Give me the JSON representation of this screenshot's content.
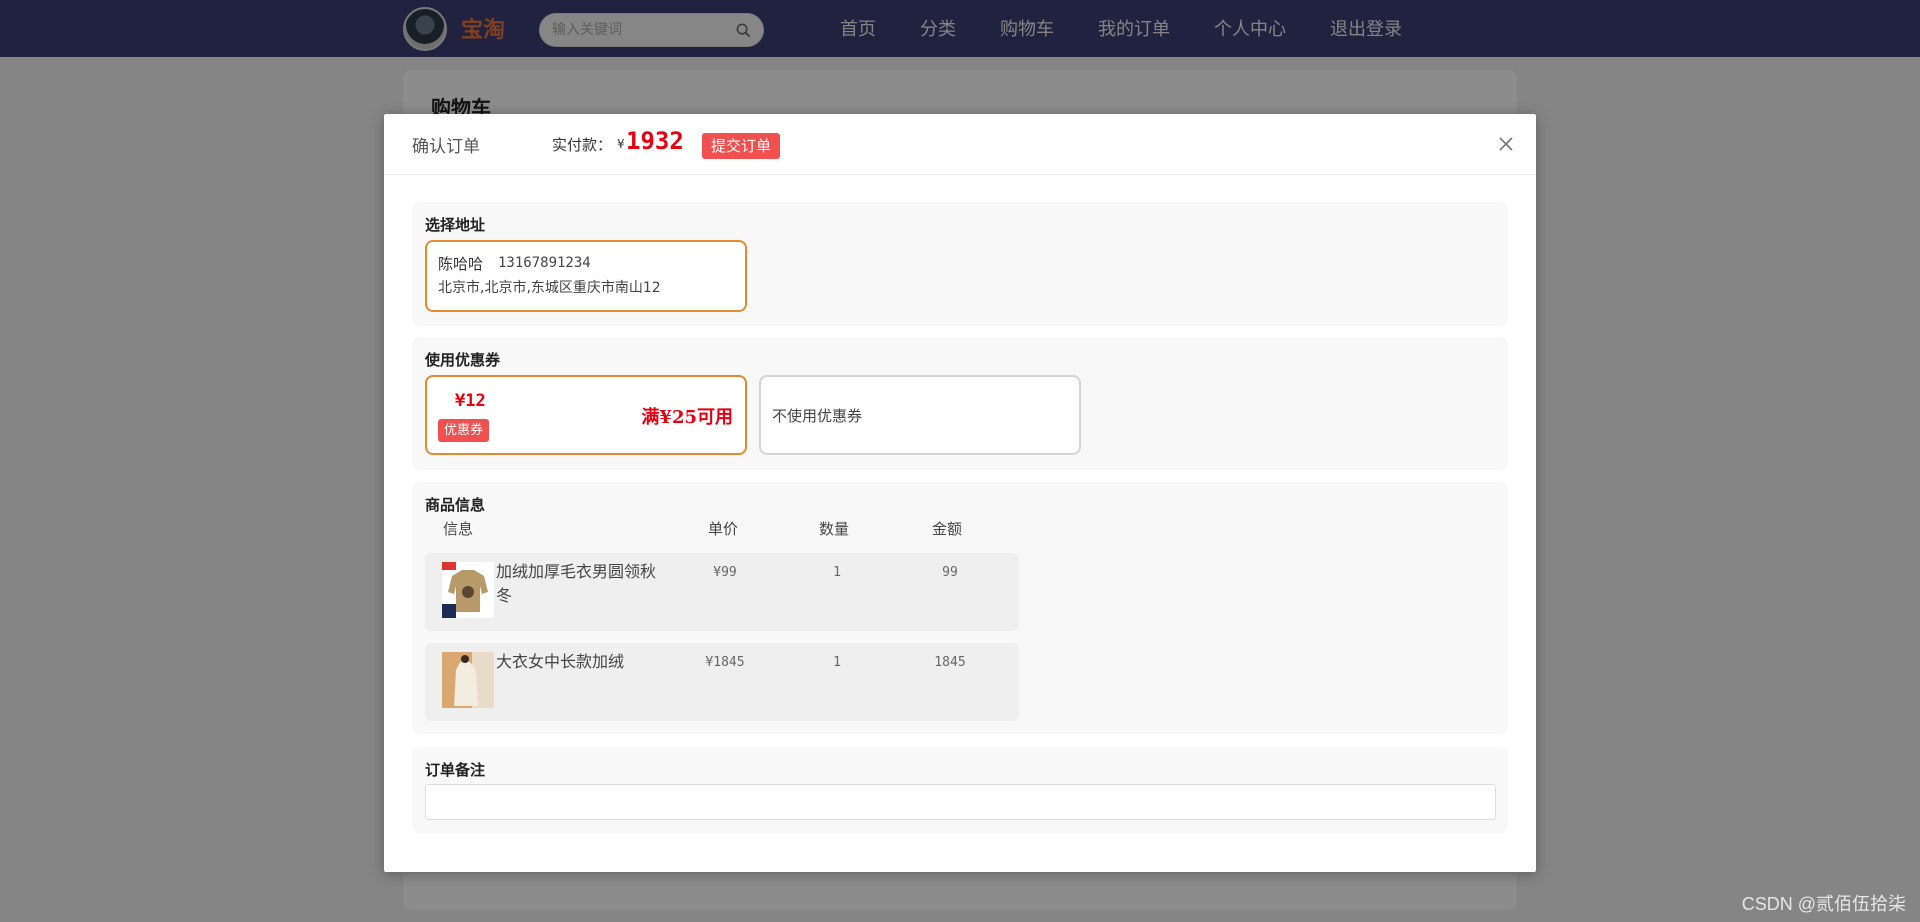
{
  "nav": {
    "logo_text": "宝淘",
    "search_placeholder": "输入关键词",
    "links": [
      "首页",
      "分类",
      "购物车",
      "我的订单",
      "个人中心",
      "退出登录"
    ]
  },
  "page": {
    "title": "购物车"
  },
  "dialog": {
    "title": "确认订单",
    "pay_label": "实付款：",
    "currency": "¥",
    "pay_amount": "1932",
    "submit_label": "提交订单"
  },
  "address": {
    "title": "选择地址",
    "name": "陈哈哈",
    "phone": "13167891234",
    "detail": "北京市,北京市,东城区重庆市南山12"
  },
  "coupon": {
    "title": "使用优惠券",
    "value": "¥12",
    "badge": "优惠券",
    "condition": "满¥25可用",
    "none_label": "不使用优惠券"
  },
  "goods": {
    "title": "商品信息",
    "columns": [
      "信息",
      "单价",
      "数量",
      "金额"
    ],
    "rows": [
      {
        "name": "加绒加厚毛衣男圆领秋冬",
        "price": "¥99",
        "qty": "1",
        "amount": "99"
      },
      {
        "name": "大衣女中长款加绒",
        "price": "¥1845",
        "qty": "1",
        "amount": "1845"
      }
    ]
  },
  "note": {
    "title": "订单备注",
    "value": ""
  },
  "watermark": "CSDN @贰佰伍拾柒",
  "colors": {
    "nav_bg": "#3b3f74",
    "accent": "#f05050",
    "price_red": "#e60012",
    "selected_border": "#e58a2f"
  }
}
